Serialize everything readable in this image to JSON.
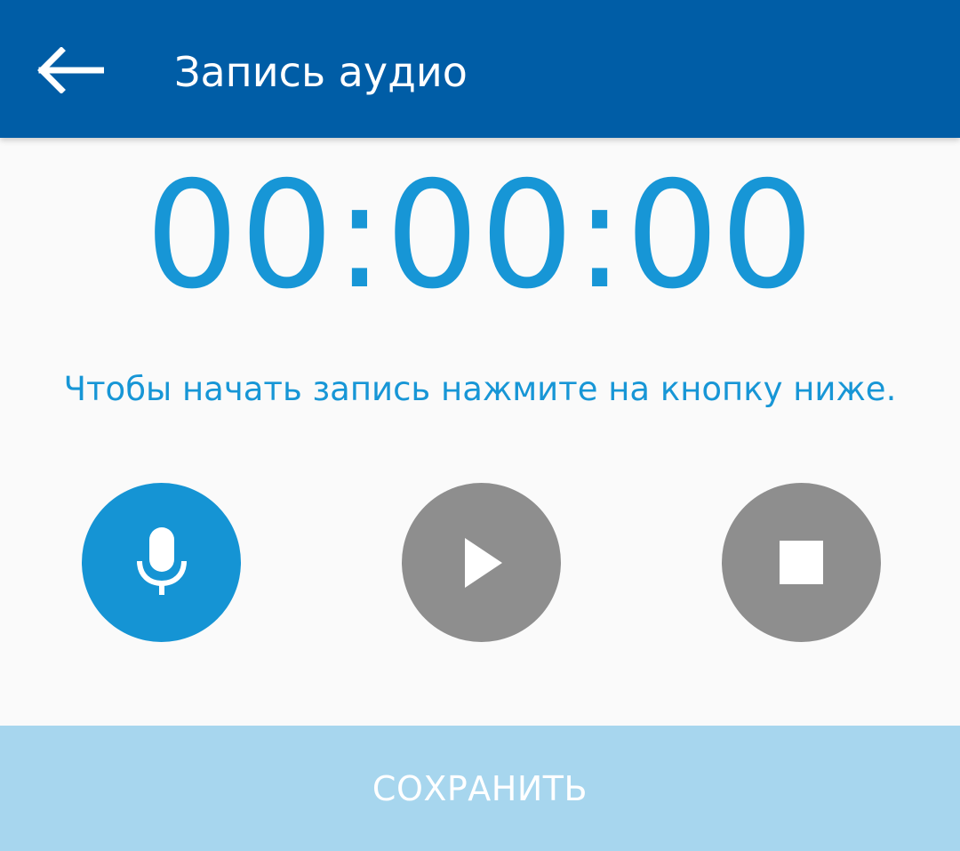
{
  "app_bar": {
    "title": "Запись аудио",
    "back_icon": "arrow-left-icon",
    "background": "#005da6"
  },
  "recorder": {
    "timer": "00:00:00",
    "hint": "Чтобы начать запись нажмите на кнопку ниже.",
    "accent_color": "#1796d6",
    "controls": [
      {
        "name": "record",
        "icon": "microphone-icon",
        "color": "#1594d4"
      },
      {
        "name": "play",
        "icon": "play-icon",
        "color": "#8e8e8e"
      },
      {
        "name": "stop",
        "icon": "stop-icon",
        "color": "#8e8e8e"
      }
    ]
  },
  "footer": {
    "save_label": "СОХРАНИТЬ",
    "background": "#a7d6ee"
  }
}
